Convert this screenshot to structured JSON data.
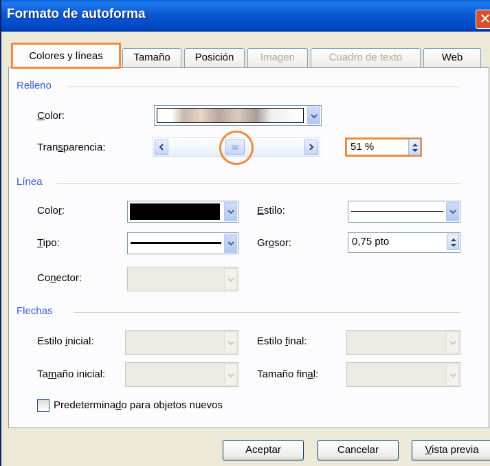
{
  "window": {
    "title": "Formato de autoforma",
    "close_glyph": "✕"
  },
  "tabs": [
    {
      "label": "Colores y líneas",
      "state": "active"
    },
    {
      "label": "Tamaño",
      "state": "normal"
    },
    {
      "label": "Posición",
      "state": "normal"
    },
    {
      "label": "Imagen",
      "state": "disabled"
    },
    {
      "label": "Cuadro de texto",
      "state": "disabled"
    },
    {
      "label": "Web",
      "state": "normal"
    }
  ],
  "fill": {
    "group_label": "Relleno",
    "color": {
      "mnemonic": "C",
      "label_rest": "olor:",
      "selected": "texture-fill"
    },
    "transparency": {
      "label_pre": "Tran",
      "mnemonic": "s",
      "label_post": "parencia:",
      "value": "51 %",
      "level": 0.51
    }
  },
  "line": {
    "group_label": "Línea",
    "color": {
      "label_pre": "Colo",
      "mnemonic": "r",
      "label_post": ":",
      "swatch": "#000000"
    },
    "style": {
      "mnemonic": "E",
      "label_rest": "stilo:"
    },
    "type": {
      "mnemonic": "T",
      "label_rest": "ipo:"
    },
    "weight": {
      "label_pre": "Gr",
      "mnemonic": "o",
      "label_post": "sor:",
      "value": "0,75 pto"
    },
    "connector": {
      "label_pre": "Co",
      "mnemonic": "n",
      "label_post": "ector:"
    }
  },
  "arrows": {
    "group_label": "Flechas",
    "begin_style": {
      "label_pre": "Estilo ",
      "mnemonic": "i",
      "label_post": "nicial:"
    },
    "end_style": {
      "label_pre": "Estilo ",
      "mnemonic": "f",
      "label_post": "inal:"
    },
    "begin_size": {
      "label_pre": "Ta",
      "mnemonic": "m",
      "label_post": "año inicial:"
    },
    "end_size": {
      "label_pre": "Tamaño fin",
      "mnemonic": "a",
      "label_post": "l:"
    }
  },
  "default_checkbox": {
    "label_pre": "Predetermina",
    "mnemonic": "d",
    "label_post": "o para objetos nuevos",
    "checked": false
  },
  "buttons": {
    "ok": "Aceptar",
    "cancel": "Cancelar",
    "preview_mnemonic": "V",
    "preview_rest": "ista previa"
  },
  "colors": {
    "highlight": "#f08a3c",
    "group_label": "#3a5ad1",
    "titlebar": "#0b57d0"
  }
}
